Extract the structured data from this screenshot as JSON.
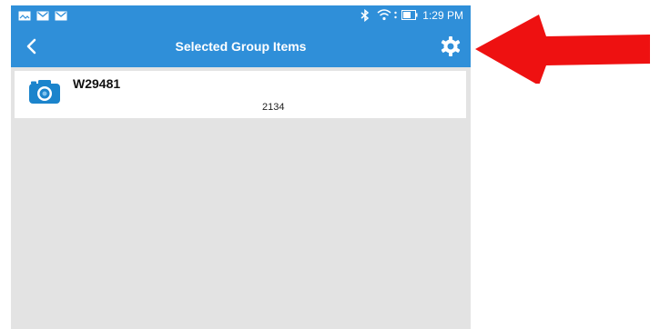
{
  "status_bar": {
    "time": "1:29 PM",
    "left_icons": [
      "image-icon",
      "mail-icon",
      "mail-icon"
    ],
    "right_icons": [
      "bluetooth-icon",
      "wifi-icon",
      "battery-icon"
    ]
  },
  "app_bar": {
    "title": "Selected Group Items",
    "back_icon": "chevron-left-icon",
    "settings_icon": "gear-icon"
  },
  "items": [
    {
      "title": "W29481",
      "value": "2134",
      "icon": "camera-icon"
    }
  ],
  "colors": {
    "primary": "#2f8fd9",
    "background": "#e3e3e3",
    "annotation_arrow": "#ee1111"
  }
}
